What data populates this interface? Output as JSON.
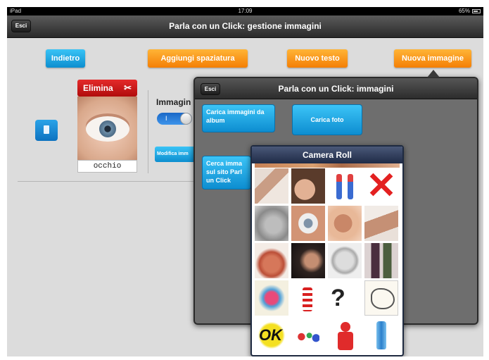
{
  "status": {
    "device": "iPad",
    "time": "17:09",
    "battery": "65%"
  },
  "navbar": {
    "exit_label": "Esci",
    "title": "Parla con un Click: gestione immagini"
  },
  "toolbar": {
    "back_label": "Indietro",
    "add_spacing_label": "Aggiungi spaziatura",
    "new_text_label": "Nuovo testo",
    "new_image_label": "Nuova immagine"
  },
  "card": {
    "delete_label": "Elimina",
    "word": "occhio"
  },
  "editor": {
    "images_label": "Immagin",
    "toggle_on_label": "I",
    "modify_label": "Modifica imm"
  },
  "popover": {
    "exit_label": "Esci",
    "title": "Parla con un Click: immagini",
    "load_album_label": "Carica immagini da album",
    "load_photo_label": "Carica foto",
    "search_site_label": "Cerca imma sul sito Parl un Click"
  },
  "camera_roll": {
    "title": "Camera Roll",
    "thumbnails": [
      "legs",
      "neck",
      "body",
      "x-mark",
      "nose",
      "eye",
      "ear",
      "hands",
      "back",
      "hand-face",
      "head",
      "couple",
      "cartoon",
      "waldo",
      "question",
      "sketch",
      "ok",
      "people",
      "red-figure",
      "bottle"
    ],
    "ok_text": "OK",
    "question_text": "?",
    "x_text": "✕"
  },
  "colors": {
    "accent_blue": "#1a9be0",
    "accent_orange": "#f7920f",
    "delete_red": "#d41a1a",
    "navbar_dark": "#2a2a2a"
  }
}
